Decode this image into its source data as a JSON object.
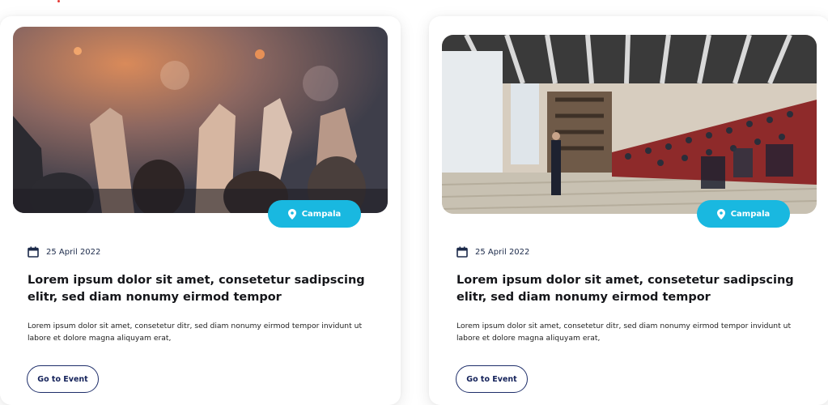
{
  "cards": [
    {
      "location": "Campala",
      "date": "25 April 2022",
      "title": "Lorem ipsum dolor sit amet, consetetur sadipscing\n elitr, sed diam nonumy eirmod tempor",
      "description": "Lorem ipsum dolor sit amet, consetetur ditr, sed diam nonumy eirmod tempor invidunt ut labore et dolore magna aliquyam erat,",
      "button_label": "Go to Event"
    },
    {
      "location": "Campala",
      "date": "25 April 2022",
      "title": "Lorem ipsum dolor sit amet, consetetur sadipscing\n elitr, sed diam nonumy eirmod tempor",
      "description": "Lorem ipsum dolor sit amet, consetetur ditr, sed diam nonumy eirmod tempor invidunt ut labore et dolore magna aliquyam erat,",
      "button_label": "Go to Event"
    }
  ],
  "colors": {
    "accent": "#19b8e0",
    "button_border": "#1e2e6a",
    "text_dark": "#15161a"
  },
  "icons": {
    "location": "map-pin-icon",
    "date": "calendar-icon"
  }
}
